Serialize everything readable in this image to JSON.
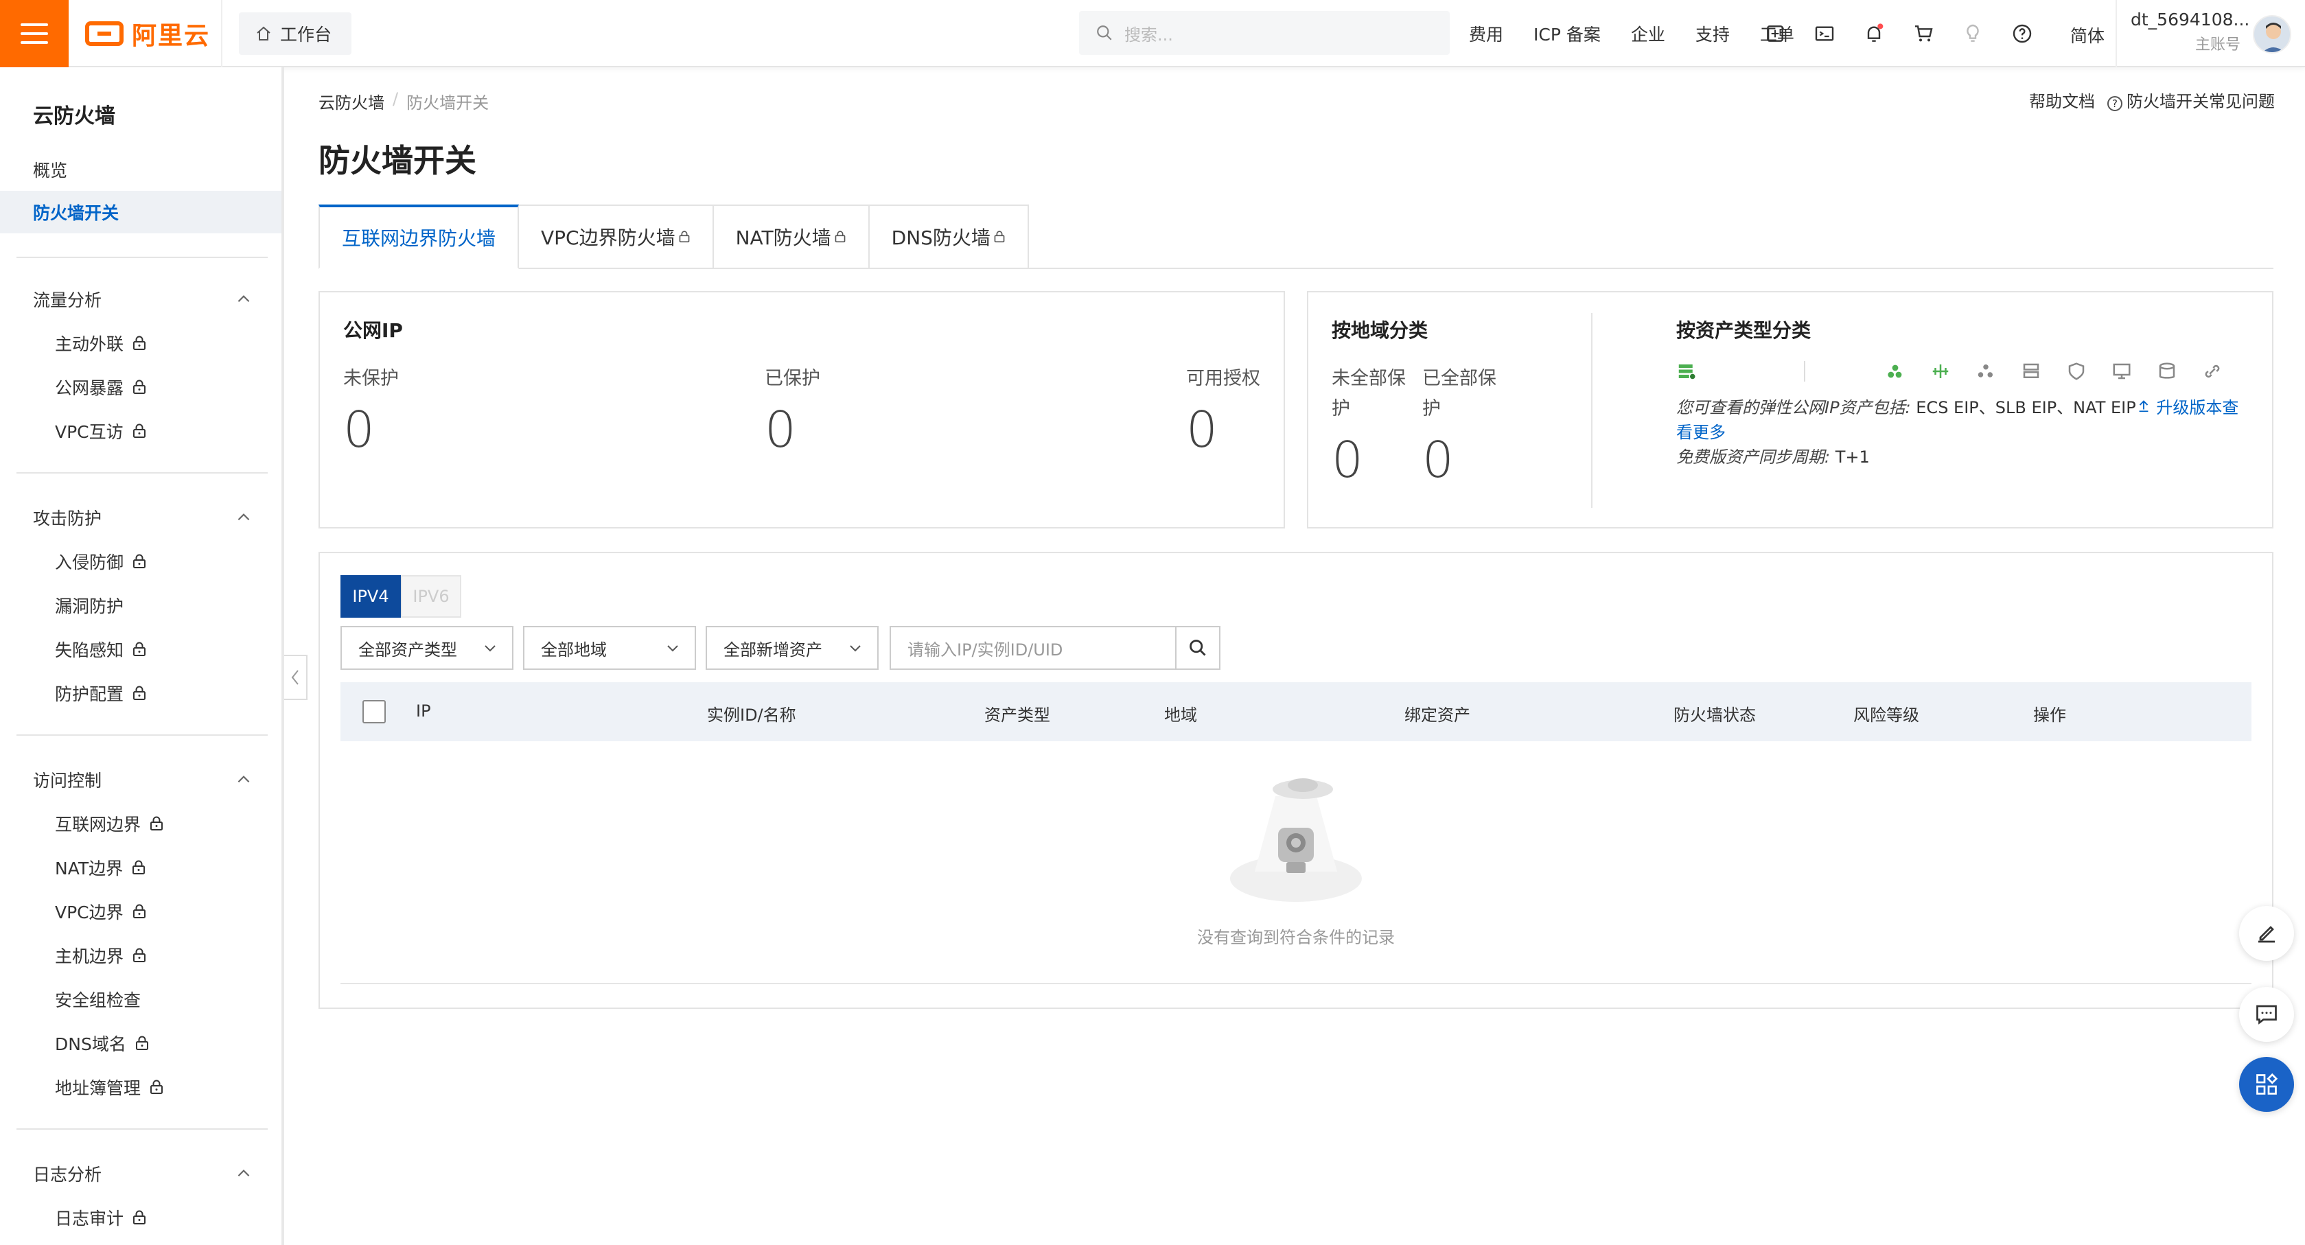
{
  "topbar": {
    "logo_text": "阿里云",
    "workbench": "工作台",
    "search_placeholder": "搜索...",
    "links": [
      "费用",
      "ICP 备案",
      "企业",
      "支持",
      "工单"
    ],
    "lang": "简体",
    "user_name": "dt_5694108...",
    "user_role": "主账号",
    "brand_color": "#ff6a00"
  },
  "sidebar": {
    "title": "云防火墙",
    "items": [
      {
        "label": "概览"
      },
      {
        "label": "防火墙开关"
      }
    ],
    "groups": [
      {
        "label": "流量分析",
        "subs": [
          "主动外联",
          "公网暴露",
          "VPC互访"
        ]
      },
      {
        "label": "攻击防护",
        "subs": [
          "入侵防御",
          "漏洞防护",
          "失陷感知",
          "防护配置"
        ]
      },
      {
        "label": "访问控制",
        "subs": [
          "互联网边界",
          "NAT边界",
          "VPC边界",
          "主机边界",
          "安全组检查",
          "DNS域名",
          "地址簿管理"
        ]
      },
      {
        "label": "日志分析",
        "subs": [
          "日志审计"
        ]
      }
    ]
  },
  "breadcrumb": {
    "root": "云防火墙",
    "current": "防火墙开关"
  },
  "help": {
    "docs": "帮助文档",
    "faq": "防火墙开关常见问题"
  },
  "page_title": "防火墙开关",
  "tabs": [
    "互联网边界防火墙",
    "VPC边界防火墙",
    "NAT防火墙",
    "DNS防火墙"
  ],
  "public_ip_card": {
    "title": "公网IP",
    "stats": [
      {
        "label": "未保护",
        "value": "0"
      },
      {
        "label": "已保护",
        "value": "0"
      },
      {
        "label": "可用授权",
        "value": "0"
      }
    ]
  },
  "region_card": {
    "title": "按地域分类",
    "stats": [
      {
        "label_line1": "未全部保",
        "label_line2": "护",
        "value": "0"
      },
      {
        "label_line1": "已全部保",
        "label_line2": "护",
        "value": "0"
      }
    ]
  },
  "asset_card": {
    "title": "按资产类型分类",
    "note_prefix": "您可查看的弹性公网IP资产包括:",
    "note_assets": " ECS EIP、SLB EIP、NAT EIP",
    "upgrade_link": "升级版本查",
    "see_more": "看更多",
    "sync_label": "免费版资产同步周期:",
    "sync_value": " T+1"
  },
  "filters": {
    "ipv4": "IPV4",
    "ipv6": "IPV6",
    "asset_type": "全部资产类型",
    "region": "全部地域",
    "new_asset": "全部新增资产",
    "search_placeholder": "请输入IP/实例ID/UID"
  },
  "table": {
    "columns": [
      "IP",
      "实例ID/名称",
      "资产类型",
      "地域",
      "绑定资产",
      "防火墙状态",
      "风险等级",
      "操作"
    ],
    "empty_text": "没有查询到符合条件的记录"
  }
}
